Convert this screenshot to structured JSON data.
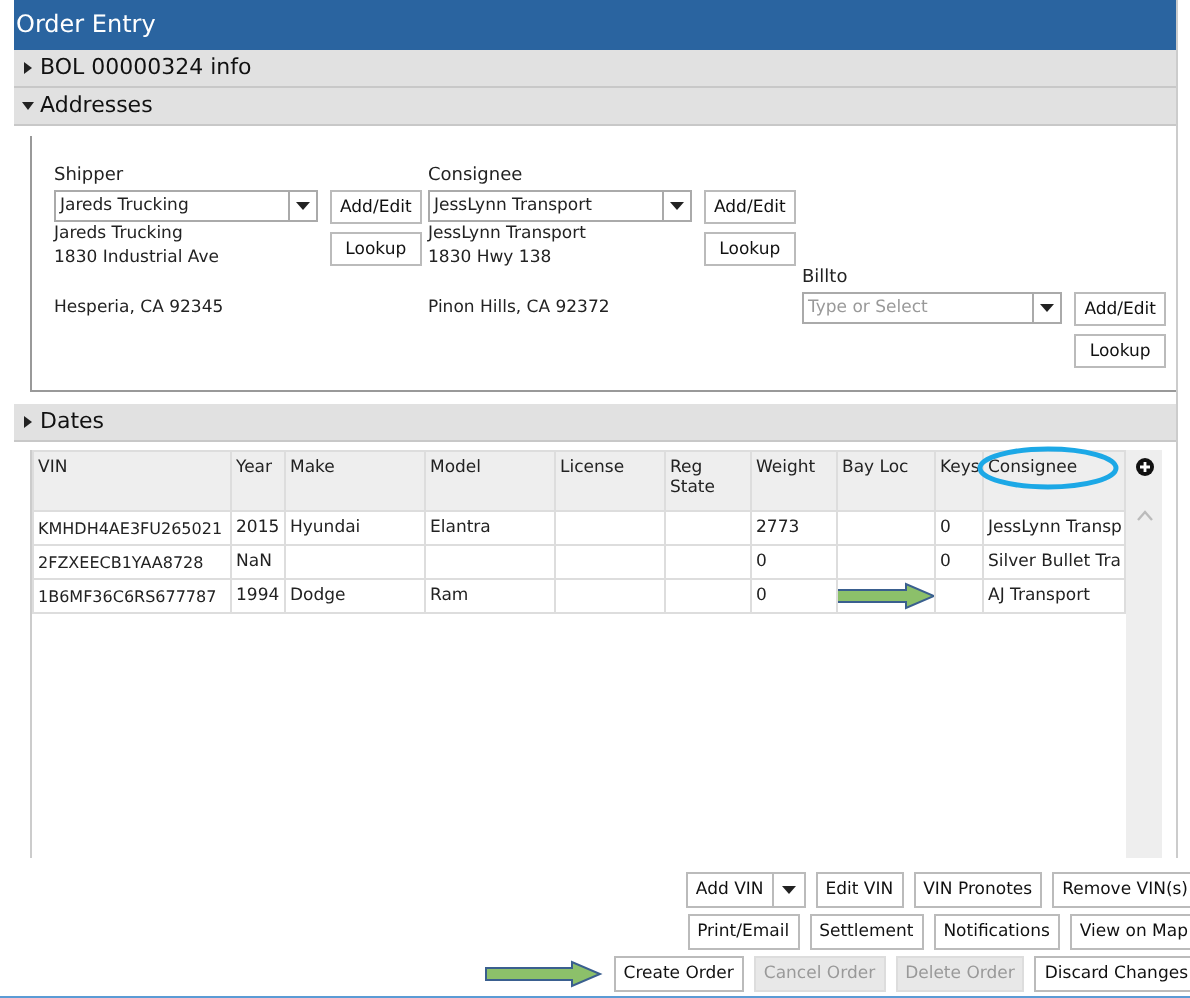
{
  "window": {
    "title": "Order Entry"
  },
  "sections": [
    {
      "label": "BOL 00000324 info",
      "expanded": false
    },
    {
      "label": "Addresses",
      "expanded": true,
      "parties": [
        {
          "label": "Shipper",
          "value": "Jareds Trucking",
          "buttons": [
            "Add/Edit",
            "Lookup"
          ],
          "name": "Jareds Trucking",
          "street": "1830 Industrial Ave",
          "city": "Hesperia, CA 92345"
        },
        {
          "label": "Consignee",
          "value": "JessLynn Transport",
          "buttons": [
            "Add/Edit",
            "Lookup"
          ],
          "name": "JessLynn Transport",
          "street": "1830 Hwy 138",
          "city": "Pinon Hills, CA 92372"
        },
        {
          "label": "Billto",
          "placeholder": "Type or Select",
          "buttons": [
            "Add/Edit",
            "Lookup"
          ]
        }
      ]
    },
    {
      "label": "Dates",
      "expanded": false
    }
  ],
  "grid": {
    "columns": [
      {
        "label": "VIN",
        "circled": false
      },
      {
        "label": "Year",
        "circled": false
      },
      {
        "label": "Make",
        "circled": false
      },
      {
        "label": "Model",
        "circled": false
      },
      {
        "label": "License",
        "circled": false
      },
      {
        "label": "Reg State",
        "circled": false
      },
      {
        "label": "Weight",
        "circled": false
      },
      {
        "label": "Bay Loc",
        "circled": false
      },
      {
        "label": "Keys",
        "circled": false
      },
      {
        "label": "Consignee",
        "circled": true
      }
    ],
    "rows": [
      {
        "cells": [
          "KMHDH4AE3FU265021",
          "2015",
          "Hyundai",
          "Elantra",
          "",
          "",
          "2773",
          "",
          "0",
          "JessLynn Transp"
        ],
        "pointed": false
      },
      {
        "cells": [
          "2FZXEECB1YAA8728",
          "NaN",
          "",
          "",
          "",
          "",
          "0",
          "",
          "0",
          "Silver Bullet Tra"
        ],
        "pointed": false
      },
      {
        "cells": [
          "1B6MF36C6RS677787",
          "1994",
          "Dodge",
          "Ram",
          "",
          "",
          "0",
          "",
          "",
          "AJ Transport"
        ],
        "pointed": true
      }
    ]
  },
  "button_rows": [
    [
      {
        "label": "Add VIN",
        "kind": "split",
        "disabled": false,
        "pointed": false
      },
      {
        "label": "Edit VIN",
        "kind": "plain",
        "disabled": false,
        "pointed": false
      },
      {
        "label": "VIN Pronotes",
        "kind": "plain",
        "disabled": false,
        "pointed": false
      },
      {
        "label": "Remove VIN(s)",
        "kind": "plain",
        "disabled": false,
        "pointed": false
      }
    ],
    [
      {
        "label": "Print/Email",
        "kind": "plain",
        "disabled": false,
        "pointed": false
      },
      {
        "label": "Settlement",
        "kind": "plain",
        "disabled": false,
        "pointed": false
      },
      {
        "label": "Notifications",
        "kind": "plain",
        "disabled": false,
        "pointed": false
      },
      {
        "label": "View on Map",
        "kind": "plain",
        "disabled": false,
        "pointed": false
      }
    ],
    [
      {
        "label": "Create Order",
        "kind": "plain",
        "disabled": false,
        "pointed": true
      },
      {
        "label": "Cancel Order",
        "kind": "plain",
        "disabled": true,
        "pointed": false
      },
      {
        "label": "Delete Order",
        "kind": "plain",
        "disabled": true,
        "pointed": false
      },
      {
        "label": "Discard Changes",
        "kind": "plain",
        "disabled": false,
        "pointed": false
      }
    ]
  ]
}
